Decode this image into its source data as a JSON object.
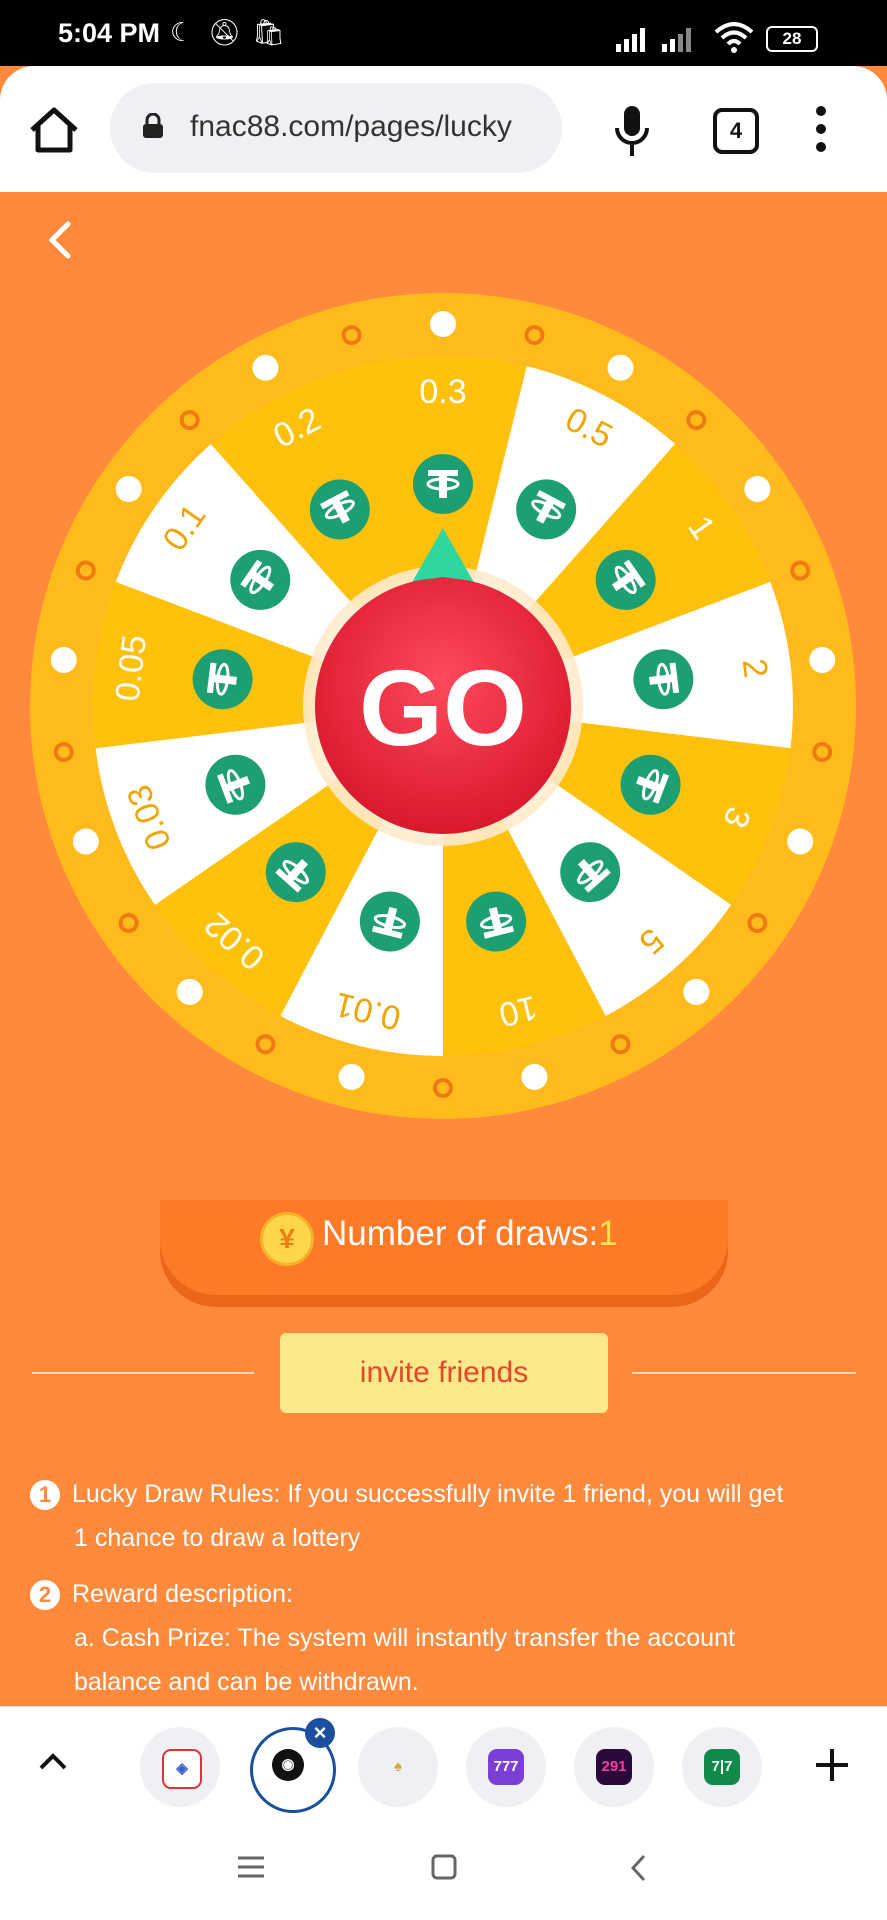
{
  "status_bar": {
    "time": "5:04 PM",
    "battery": "28"
  },
  "browser": {
    "url": "fnac88.com/pages/lucky",
    "tab_count": "4"
  },
  "wheel": {
    "center_label": "GO",
    "segments": [
      "0.3",
      "0.5",
      "1",
      "2",
      "3",
      "5",
      "10",
      "0.01",
      "0.02",
      "0.03",
      "0.05",
      "0.1",
      "0.2"
    ],
    "colors": {
      "yellow": "#ffc10c",
      "white": "#ffffff",
      "rim": "#ffbb1c",
      "coin": "#1e9f72",
      "go": "#e8263c"
    }
  },
  "draws": {
    "label": "Number of draws:",
    "count": "1",
    "coin_symbol": "¥"
  },
  "invite_button": "invite friends",
  "rules": [
    {
      "num": "1",
      "lines": [
        "Lucky Draw Rules: If you successfully invite 1 friend, you will get",
        "1 chance to draw a lottery"
      ]
    },
    {
      "num": "2",
      "lines": [
        "Reward description:",
        "a. Cash Prize: The system will instantly transfer the account",
        "balance and can be withdrawn."
      ]
    }
  ],
  "bottom_tabs": [
    "shield-app-icon",
    "globe-icon",
    "spade-app-icon",
    "777-app-icon",
    "291-app-icon",
    "777-green-app-icon"
  ],
  "bottom_tab_labels": {
    "t3": "777",
    "t4": "291",
    "t5": "7|7"
  }
}
